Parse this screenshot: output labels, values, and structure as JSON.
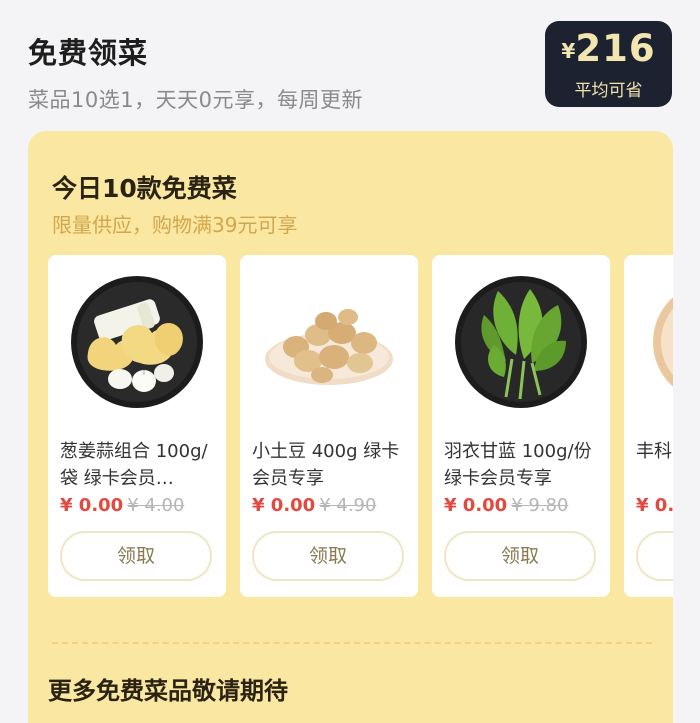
{
  "header": {
    "title": "免费领菜",
    "subtitle": "菜品10选1，天天0元享，每周更新",
    "savings": {
      "currency": "¥",
      "amount": "216",
      "label": "平均可省"
    }
  },
  "promo": {
    "title": "今日10款免费菜",
    "subtitle": "限量供应，购物满39元可享",
    "products": [
      {
        "name": "葱姜蒜组合 100g/袋 绿卡会员…",
        "price": "¥ 0.00",
        "original_price": "¥ 4.00",
        "button": "领取",
        "icon": "garlic-ginger-icon"
      },
      {
        "name": "小土豆 400g 绿卡会员专享",
        "price": "¥ 0.00",
        "original_price": "¥ 4.90",
        "button": "领取",
        "icon": "potato-icon"
      },
      {
        "name": "羽衣甘蓝 100g/份 绿卡会员专享",
        "price": "¥ 0.00",
        "original_price": "¥ 9.80",
        "button": "领取",
        "icon": "kale-icon"
      },
      {
        "name": "丰科g/份",
        "price": "¥ 0.",
        "original_price": "",
        "button": "",
        "icon": "produce-icon"
      }
    ],
    "more_text": "更多免费菜品敬请期待"
  },
  "colors": {
    "page_bg": "#f4f4f6",
    "panel_bg": "#fae7a2",
    "badge_bg": "#1d2230",
    "badge_text": "#f3e5b0",
    "price_red": "#e5483e",
    "subtitle_gold": "#d4a64c"
  }
}
